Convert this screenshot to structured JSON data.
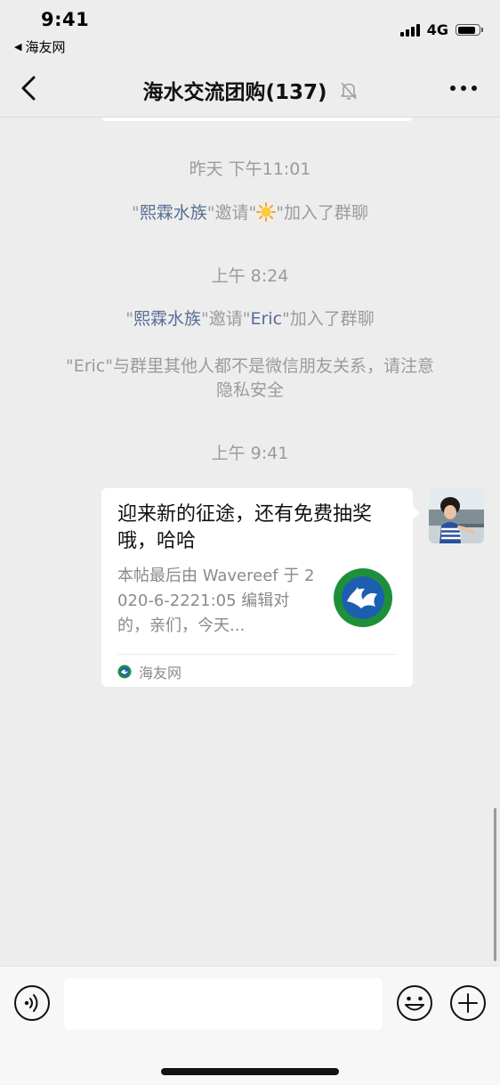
{
  "status_bar": {
    "time": "9:41",
    "back_app_label": "海友网",
    "network": "4G",
    "signal_bars": 4,
    "battery_level": 0.85
  },
  "nav": {
    "title": "海水交流团购(137)",
    "back_icon": "chevron-left-icon",
    "mute_icon": "bell-slash-icon",
    "more_icon": "ellipsis-icon"
  },
  "messages": {
    "timestamp_1": "昨天 下午11:01",
    "sys_1": {
      "quote_open": "\"",
      "inviter": "熙霖水族",
      "middle": "\"邀请\"",
      "invitee_emoji": "sun-emoji",
      "tail": "\"加入了群聊"
    },
    "timestamp_2": "上午 8:24",
    "sys_2": {
      "quote_open": "\"",
      "inviter": "熙霖水族",
      "middle": "\"邀请\"",
      "invitee": "Eric",
      "tail": "\"加入了群聊"
    },
    "sys_3": {
      "line1": "\"Eric\"与群里其他人都不是微信朋友关系，请注意",
      "line2": "隐私安全"
    },
    "timestamp_3": "上午 9:41",
    "link_card": {
      "title": "迎来新的征途，还有免费抽奖哦，哈哈",
      "description": "本帖最后由 Wavereef 于 2020-6-2221:05 编辑对的，亲们，今天...",
      "source": "海友网",
      "thumb_icon": "aquarium-logo-icon",
      "source_icon": "haiyou-logo-icon"
    }
  },
  "input_bar": {
    "placeholder": "",
    "voice_icon": "voice-icon",
    "emoji_icon": "smiley-icon",
    "plus_icon": "plus-circle-icon"
  },
  "colors": {
    "background": "#ededed",
    "system_text": "#9b9b9b",
    "name_link": "#576b95",
    "bubble": "#ffffff",
    "logo_green": "#1e8f3a",
    "logo_blue": "#1c5fb0"
  }
}
